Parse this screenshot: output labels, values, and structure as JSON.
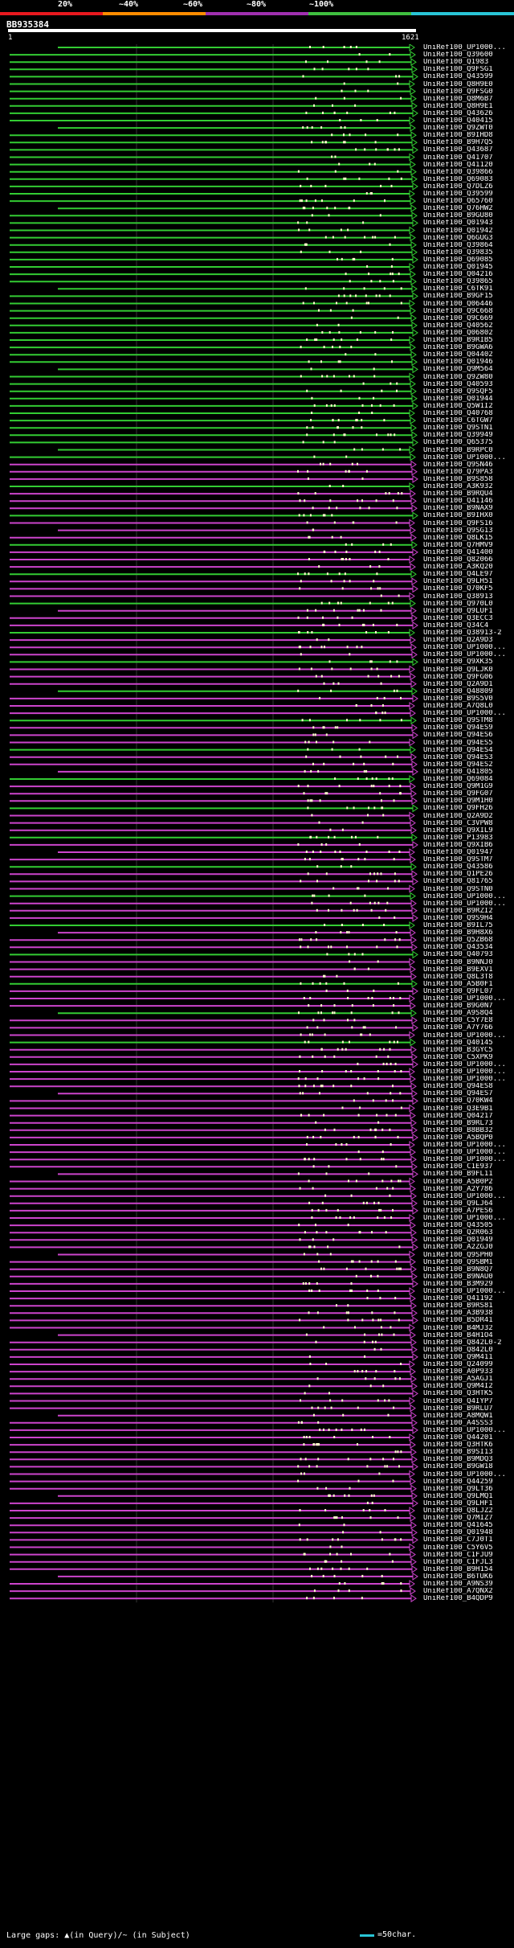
{
  "legend": {
    "labels": [
      "20%",
      "~40%",
      "~60%",
      "~80%",
      "~100%"
    ],
    "colors": [
      "#e8191f",
      "#ff8c00",
      "#a030b0",
      "#3fbf3f",
      "#29c5d6"
    ]
  },
  "query": {
    "id": "BB935384",
    "start_label": "1",
    "end_label": "1621"
  },
  "hit_colors": {
    "high": "#33cc33",
    "mid": "#cc44cc"
  },
  "hits": [
    "UniRef100_UP1000...",
    "UniRef100_Q39600",
    "UniRef100_Q1983",
    "UniRef100_Q9FSG1",
    "UniRef100_Q43599",
    "UniRef100_Q8H9E0",
    "UniRef100_Q9FSG0",
    "UniRef100_Q8M6B7",
    "UniRef100_Q8H9E1",
    "UniRef100_Q43626",
    "UniRef100_Q40415",
    "UniRef100_Q9ZWT0",
    "UniRef100_B9IHD8",
    "UniRef100_B9H7Q5",
    "UniRef100_Q43687",
    "UniRef100_Q41707",
    "UniRef100_Q41120",
    "UniRef100_Q39866",
    "UniRef100_Q69083",
    "UniRef100_Q7DLZ6",
    "UniRef100_Q39599",
    "UniRef100_Q65760",
    "UniRef100_Q76HW2",
    "UniRef100_B9GU80",
    "UniRef100_Q01943",
    "UniRef100_Q01942",
    "UniRef100_Q6GUG3",
    "UniRef100_Q39864",
    "UniRef100_Q39835",
    "UniRef100_Q69085",
    "UniRef100_Q01945",
    "UniRef100_Q04216",
    "UniRef100_Q39865",
    "UniRef100_C6TK91",
    "UniRef100_B9GF15",
    "UniRef100_Q06446",
    "UniRef100_Q9C668",
    "UniRef100_Q9C669",
    "UniRef100_Q40562",
    "UniRef100_Q06802",
    "UniRef100_B9RIB5",
    "UniRef100_B9GWA6",
    "UniRef100_Q04402",
    "UniRef100_Q01946",
    "UniRef100_Q9M564",
    "UniRef100_Q9ZW80",
    "UniRef100_Q40593",
    "UniRef100_Q9SQF5",
    "UniRef100_Q01944",
    "UniRef100_Q5W1I2",
    "UniRef100_Q40768",
    "UniRef100_C6TGW7",
    "UniRef100_Q9STN1",
    "UniRef100_Q39949",
    "UniRef100_Q65375",
    "UniRef100_B9RPC0",
    "UniRef100_UP1000...",
    "UniRef100_Q9SN46",
    "UniRef100_Q79PA3",
    "UniRef100_B9S858",
    "UniRef100_A3K932",
    "UniRef100_B9RQU4",
    "UniRef100_Q41146",
    "UniRef100_B9NAX9",
    "UniRef100_B9IHX0",
    "UniRef100_Q9FS16",
    "UniRef100_Q9SG13",
    "UniRef100_Q8LK15",
    "UniRef100_Q7HMV9",
    "UniRef100_Q41400",
    "UniRef100_Q82066",
    "UniRef100_A3KQ20",
    "UniRef100_Q4LE97",
    "UniRef100_Q9LH51",
    "UniRef100_Q70KF5",
    "UniRef100_Q38913",
    "UniRef100_Q970L0",
    "UniRef100_Q9LUF1",
    "UniRef100_Q3ECC3",
    "UniRef100_Q34C4",
    "UniRef100_Q38913-2",
    "UniRef100_Q2A9D3",
    "UniRef100_UP1000...",
    "UniRef100_UP1000...",
    "UniRef100_Q9XK35",
    "UniRef100_Q9LJK0",
    "UniRef100_Q9FG06",
    "UniRef100_Q2A9D1",
    "UniRef100_Q48809",
    "UniRef100_B9S5V0",
    "UniRef100_A7Q8L0",
    "UniRef100_UP1000...",
    "UniRef100_Q9STM8",
    "UniRef100_Q94ES9",
    "UniRef100_Q94ES6",
    "UniRef100_Q94ES5",
    "UniRef100_Q94ES4",
    "UniRef100_Q94ES3",
    "UniRef100_Q94ES2",
    "UniRef100_Q41805",
    "UniRef100_Q69084",
    "UniRef100_Q9M1G9",
    "UniRef100_Q9FG07",
    "UniRef100_Q9M1H0",
    "UniRef100_Q9FH26",
    "UniRef100_Q2A9D2",
    "UniRef100_C3VPW8",
    "UniRef100_Q9XIL9",
    "UniRef100_P13983",
    "UniRef100_Q9XIB6",
    "UniRef100_Q01947",
    "UniRef100_Q9STM7",
    "UniRef100_Q43586",
    "UniRef100_Q1PE26",
    "UniRef100_Q81765",
    "UniRef100_Q9STN0",
    "UniRef100_UP1000...",
    "UniRef100_UP1000...",
    "UniRef100_B9RZI2",
    "UniRef100_Q9S9H4",
    "UniRef100_B9IL75",
    "UniRef100_B9H8X6",
    "UniRef100_Q5ZB68",
    "UniRef100_Q43534",
    "UniRef100_Q40793",
    "UniRef100_B9NNJ0",
    "UniRef100_B9EXV1",
    "UniRef100_Q8L3T8",
    "UniRef100_A5B0F1",
    "UniRef100_Q9FL07",
    "UniRef100_UP1000...",
    "UniRef100_B9G0N7",
    "UniRef100_A9S8Q4",
    "UniRef100_C5Y7E8",
    "UniRef100_A7Y766",
    "UniRef100_UP1000...",
    "UniRef100_Q40145",
    "UniRef100_B3GYC5",
    "UniRef100_C5XPK9",
    "UniRef100_UP1000...",
    "UniRef100_UP1000...",
    "UniRef100_UP1000...",
    "UniRef100_Q94ES8",
    "UniRef100_Q94ES7",
    "UniRef100_Q70KW4",
    "UniRef100_Q3E9B1",
    "UniRef100_Q04217",
    "UniRef100_B9RL73",
    "UniRef100_B8BB32",
    "UniRef100_A5BQP0",
    "UniRef100_UP1000...",
    "UniRef100_UP1000...",
    "UniRef100_UP1000...",
    "UniRef100_C1E937",
    "UniRef100_B9FL11",
    "UniRef100_A5B0P2",
    "UniRef100_A2Y786",
    "UniRef100_UP1000...",
    "UniRef100_Q9LJ64",
    "UniRef100_A7PES6",
    "UniRef100_UP1000...",
    "UniRef100_Q43505",
    "UniRef100_Q2R063",
    "UniRef100_Q01949",
    "UniRef100_A2ZGJ0",
    "UniRef100_Q9SPH0",
    "UniRef100_Q9SBM1",
    "UniRef100_B9N8Q7",
    "UniRef100_B9NAU0",
    "UniRef100_B3M929",
    "UniRef100_UP1000...",
    "UniRef100_Q41192",
    "UniRef100_B9RS81",
    "UniRef100_A3B938",
    "UniRef100_B5DR41",
    "UniRef100_B4MJ32",
    "UniRef100_B4H1O4",
    "UniRef100_Q842L0-2",
    "UniRef100_Q842L0",
    "UniRef100_Q9M411",
    "UniRef100_Q24099",
    "UniRef100_A0P933",
    "UniRef100_A5AGJ1",
    "UniRef100_Q9M4I2",
    "UniRef100_Q3HTK5",
    "UniRef100_Q4IYP7",
    "UniRef100_B9RLU7",
    "UniRef100_A8MQW1",
    "UniRef100_A4SSS3",
    "UniRef100_UP1000...",
    "UniRef100_Q44201",
    "UniRef100_Q3HTK6",
    "UniRef100_B9SI13",
    "UniRef100_B9MDQ3",
    "UniRef100_B9GW18",
    "UniRef100_UP1000...",
    "UniRef100_Q44259",
    "UniRef100_Q9LT36",
    "UniRef100_Q9LMQ1",
    "UniRef100_Q9LHF1",
    "UniRef100_Q8LJZ2",
    "UniRef100_Q7MIZ7",
    "UniRef100_Q41645",
    "UniRef100_Q01948",
    "UniRef100_C7J0T1",
    "UniRef100_C5Y6V5",
    "UniRef100_C1FJU9",
    "UniRef100_C1FJL3",
    "UniRef100_B9H154",
    "UniRef100_B6TUK6",
    "UniRef100_A9NS39",
    "UniRef100_A7QNX2",
    "UniRef100_B4QDP9"
  ],
  "footer": {
    "large_gaps": "Large gaps: ▲(in Query)/~ (in Subject)",
    "scale": "=50char."
  }
}
